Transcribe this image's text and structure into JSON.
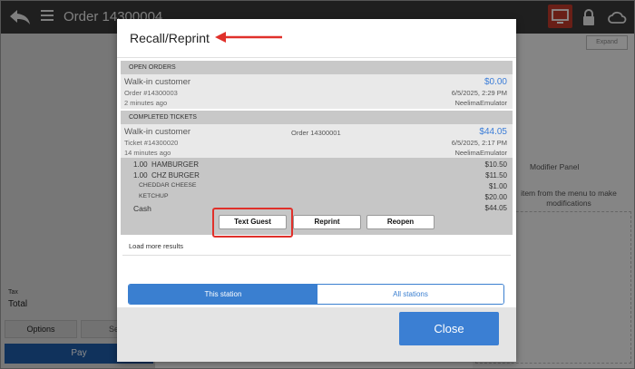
{
  "header": {
    "title": "Order 14300004"
  },
  "colors": {
    "accent": "#3b7fd3",
    "screen_icon_bg": "#c0392b",
    "highlight": "#e0302a"
  },
  "left_panel": {
    "tax_label": "Tax",
    "total_label": "Total",
    "options_label": "Options",
    "second_label": "Se",
    "pay_label": "Pay"
  },
  "right_panel": {
    "expand_label": "Expand",
    "modifier_title": "Modifier Panel",
    "modifier_desc": "item from the menu to make modifications"
  },
  "modal": {
    "title": "Recall/Reprint",
    "open_orders": {
      "header": "OPEN ORDERS",
      "orders": [
        {
          "customer": "Walk-in customer",
          "number": "Order #14300003",
          "age": "2 minutes ago",
          "amount": "$0.00",
          "date": "6/5/2025, 2:29 PM",
          "device": "NeelimaEmulator"
        }
      ]
    },
    "completed": {
      "header": "COMPLETED TICKETS",
      "tickets": [
        {
          "customer": "Walk-in customer",
          "number": "Ticket #14300020",
          "age": "14 minutes ago",
          "order_ref": "Order 14300001",
          "amount": "$44.05",
          "date": "6/5/2025, 2:17 PM",
          "device": "NeelimaEmulator"
        }
      ],
      "items": [
        {
          "label": "1.00  HAMBURGER",
          "price": "$10.50",
          "kind": "item"
        },
        {
          "label": "1.00  CHZ BURGER",
          "price": "$11.50",
          "kind": "item"
        },
        {
          "label": "CHEDDAR CHEESE",
          "price": "$1.00",
          "kind": "mod"
        },
        {
          "label": "KETCHUP",
          "price": "$20.00",
          "kind": "mod"
        },
        {
          "label": "Cash",
          "price": "$44.05",
          "kind": "cash"
        }
      ],
      "actions": {
        "text_guest": "Text Guest",
        "reprint": "Reprint",
        "reopen": "Reopen"
      }
    },
    "load_more": "Load more results",
    "station_toggle": {
      "this": "This station",
      "all": "All stations",
      "selected": "This station"
    },
    "close_label": "Close"
  }
}
